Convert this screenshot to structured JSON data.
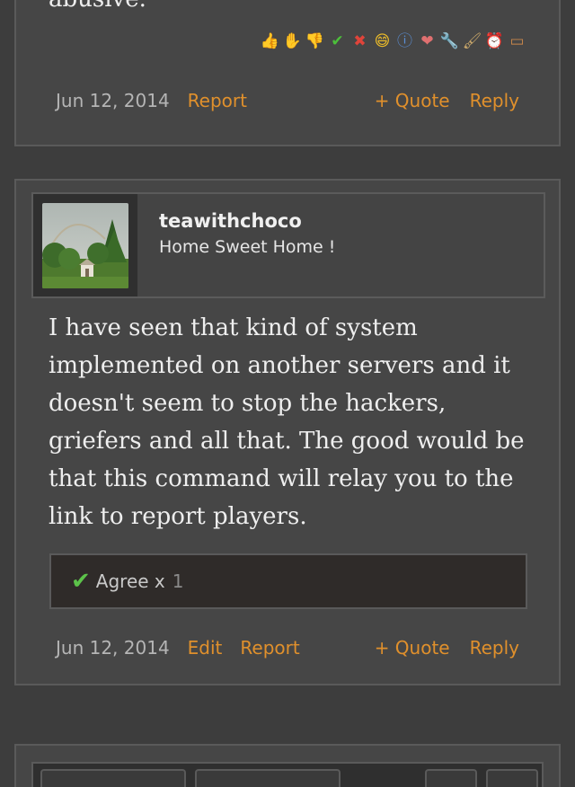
{
  "previous_post": {
    "tail_text": "abusive.",
    "reactions": [
      {
        "icon": "thumbs-up-icon",
        "glyph": "👍",
        "color": "#c9874a"
      },
      {
        "icon": "hand-wave-icon",
        "glyph": "✋",
        "color": "#c9874a"
      },
      {
        "icon": "thumbs-down-icon",
        "glyph": "👎",
        "color": "#c9874a"
      },
      {
        "icon": "check-icon",
        "glyph": "✔",
        "color": "#4cbf3a"
      },
      {
        "icon": "cross-icon",
        "glyph": "✖",
        "color": "#e0443a"
      },
      {
        "icon": "laugh-icon",
        "glyph": "😄",
        "color": "#f2c028"
      },
      {
        "icon": "info-icon",
        "glyph": "ⓘ",
        "color": "#5a8fd6"
      },
      {
        "icon": "heart-icon",
        "glyph": "❤",
        "color": "#e07070"
      },
      {
        "icon": "wrench-icon",
        "glyph": "🔧",
        "color": "#c79a5a"
      },
      {
        "icon": "brush-icon",
        "glyph": "🖌",
        "color": "#c9a76a"
      },
      {
        "icon": "alarm-clock-icon",
        "glyph": "⏰",
        "color": "#e05a4a"
      },
      {
        "icon": "box-icon",
        "glyph": "▭",
        "color": "#c9874a"
      }
    ],
    "date": "Jun 12, 2014",
    "report": "Report",
    "quote": "+ Quote",
    "reply": "Reply"
  },
  "post": {
    "username": "teawithchoco",
    "user_title": "Home Sweet Home !",
    "body": "I have seen that kind of system implemented on another servers and it doesn't seem to stop the hackers, griefers and all that. The good would be that this command will relay you to the link to report players.",
    "likes": {
      "label": "Agree x",
      "count": "1"
    },
    "date": "Jun 12, 2014",
    "edit": "Edit",
    "report": "Report",
    "quote": "+ Quote",
    "reply": "Reply"
  },
  "colors": {
    "link": "#e0902c",
    "background": "#3d3d3d",
    "panel": "#464646",
    "agree_check": "#5cc34a"
  }
}
